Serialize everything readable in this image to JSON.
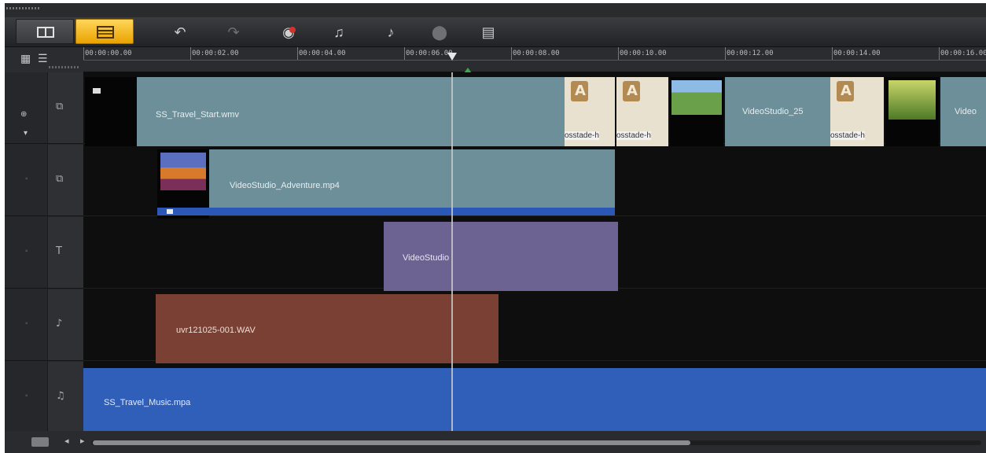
{
  "app": {
    "view_buttons": [
      {
        "name": "storyboard-view-button",
        "icon": "storyboard-icon"
      },
      {
        "name": "timeline-view-button",
        "icon": "timeline-icon"
      }
    ],
    "colors": {
      "accent": "#f2b81c",
      "video_clip": "#6d8f99",
      "title_clip": "#6c6393",
      "voice_clip": "#7a4033",
      "music_clip": "#2f5fb8",
      "background": "#1a1b1d"
    }
  },
  "toolbar": {
    "tools": [
      {
        "icon": "undo-icon",
        "glyph": "↶"
      },
      {
        "icon": "redo-icon",
        "glyph": "↷"
      },
      {
        "icon": "record-capture-icon",
        "glyph": "◉"
      },
      {
        "icon": "sound-mixer-icon",
        "glyph": "♫"
      },
      {
        "icon": "auto-music-icon",
        "glyph": "♪"
      },
      {
        "icon": "motion-tracking-icon",
        "glyph": "⬤"
      },
      {
        "icon": "subtitle-editor-icon",
        "glyph": "▤"
      }
    ]
  },
  "ruler": {
    "ticks": [
      "00:00:00.00",
      "00:00:02.00",
      "00:00:04.00",
      "00:00:06.00",
      "00:00:08.00",
      "00:00:10.00",
      "00:00:12.00",
      "00:00:14.00",
      "00:00:16.00"
    ]
  },
  "tracks": {
    "video": {
      "clip_main": "SS_Travel_Start.wmv",
      "clip_second": "VideoStudio_25",
      "crossfade_a": "osstade-h",
      "crossfade_b": "osstade-h",
      "crossfade_c": "osstade-h",
      "clip_end": "Video"
    },
    "overlay": {
      "clip": "VideoStudio_Adventure.mp4"
    },
    "title": {
      "clip": "VideoStudio"
    },
    "voice": {
      "clip": "uvr121025-001.WAV"
    },
    "music": {
      "clip": "SS_Travel_Music.mpa"
    }
  },
  "headers": [
    {
      "icon": "video-track-icon",
      "glyph": "⧉"
    },
    {
      "icon": "overlay-track-icon",
      "glyph": "⧉"
    },
    {
      "icon": "title-track-icon",
      "glyph": "T"
    },
    {
      "icon": "voice-track-icon",
      "glyph": "♪"
    },
    {
      "icon": "music-track-icon",
      "glyph": "♫"
    }
  ]
}
